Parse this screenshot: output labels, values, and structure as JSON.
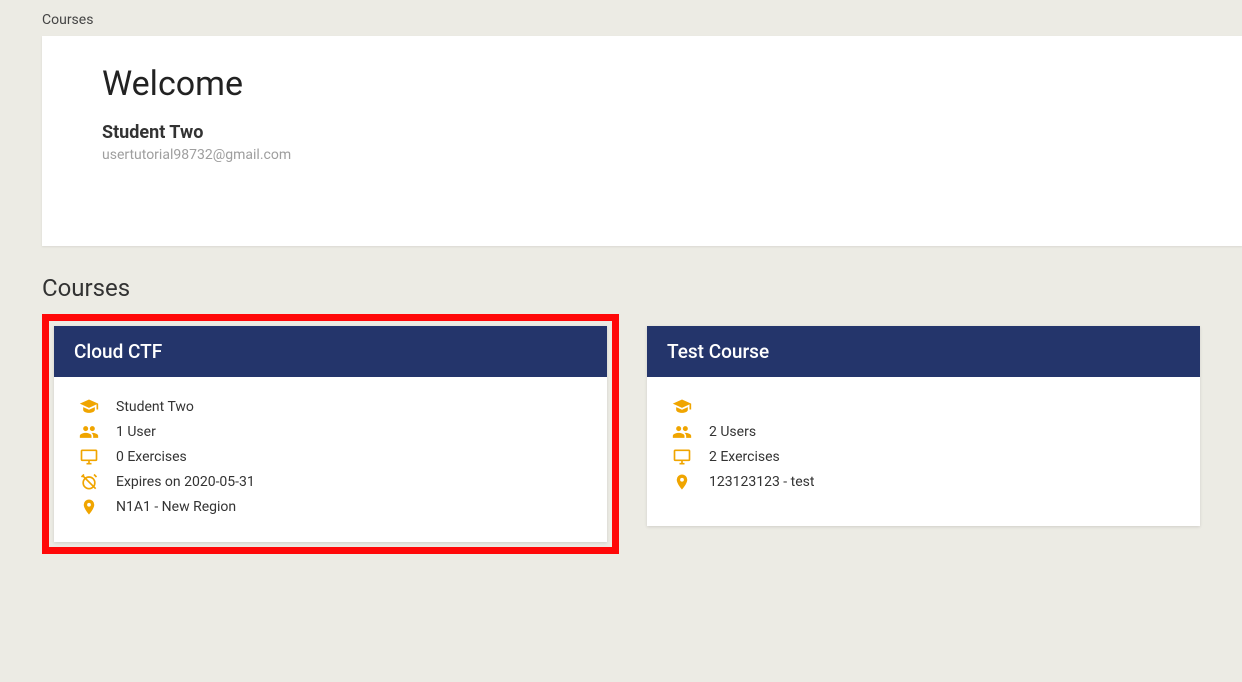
{
  "breadcrumb": "Courses",
  "welcome": {
    "title": "Welcome",
    "name": "Student Two",
    "email": "usertutorial98732@gmail.com"
  },
  "section_title": "Courses",
  "colors": {
    "header_bg": "#24356b",
    "icon": "#f0a500",
    "highlight": "#ff0808"
  },
  "courses": [
    {
      "title": "Cloud CTF",
      "highlighted": true,
      "rows": {
        "owner": "Student Two",
        "users": "1 User",
        "exercises": "0 Exercises",
        "expires": "Expires on 2020-05-31",
        "location": "N1A1 - New Region"
      }
    },
    {
      "title": "Test Course",
      "highlighted": false,
      "rows": {
        "owner": "",
        "users": "2 Users",
        "exercises": "2 Exercises",
        "expires": "",
        "location": "123123123 - test"
      }
    }
  ]
}
